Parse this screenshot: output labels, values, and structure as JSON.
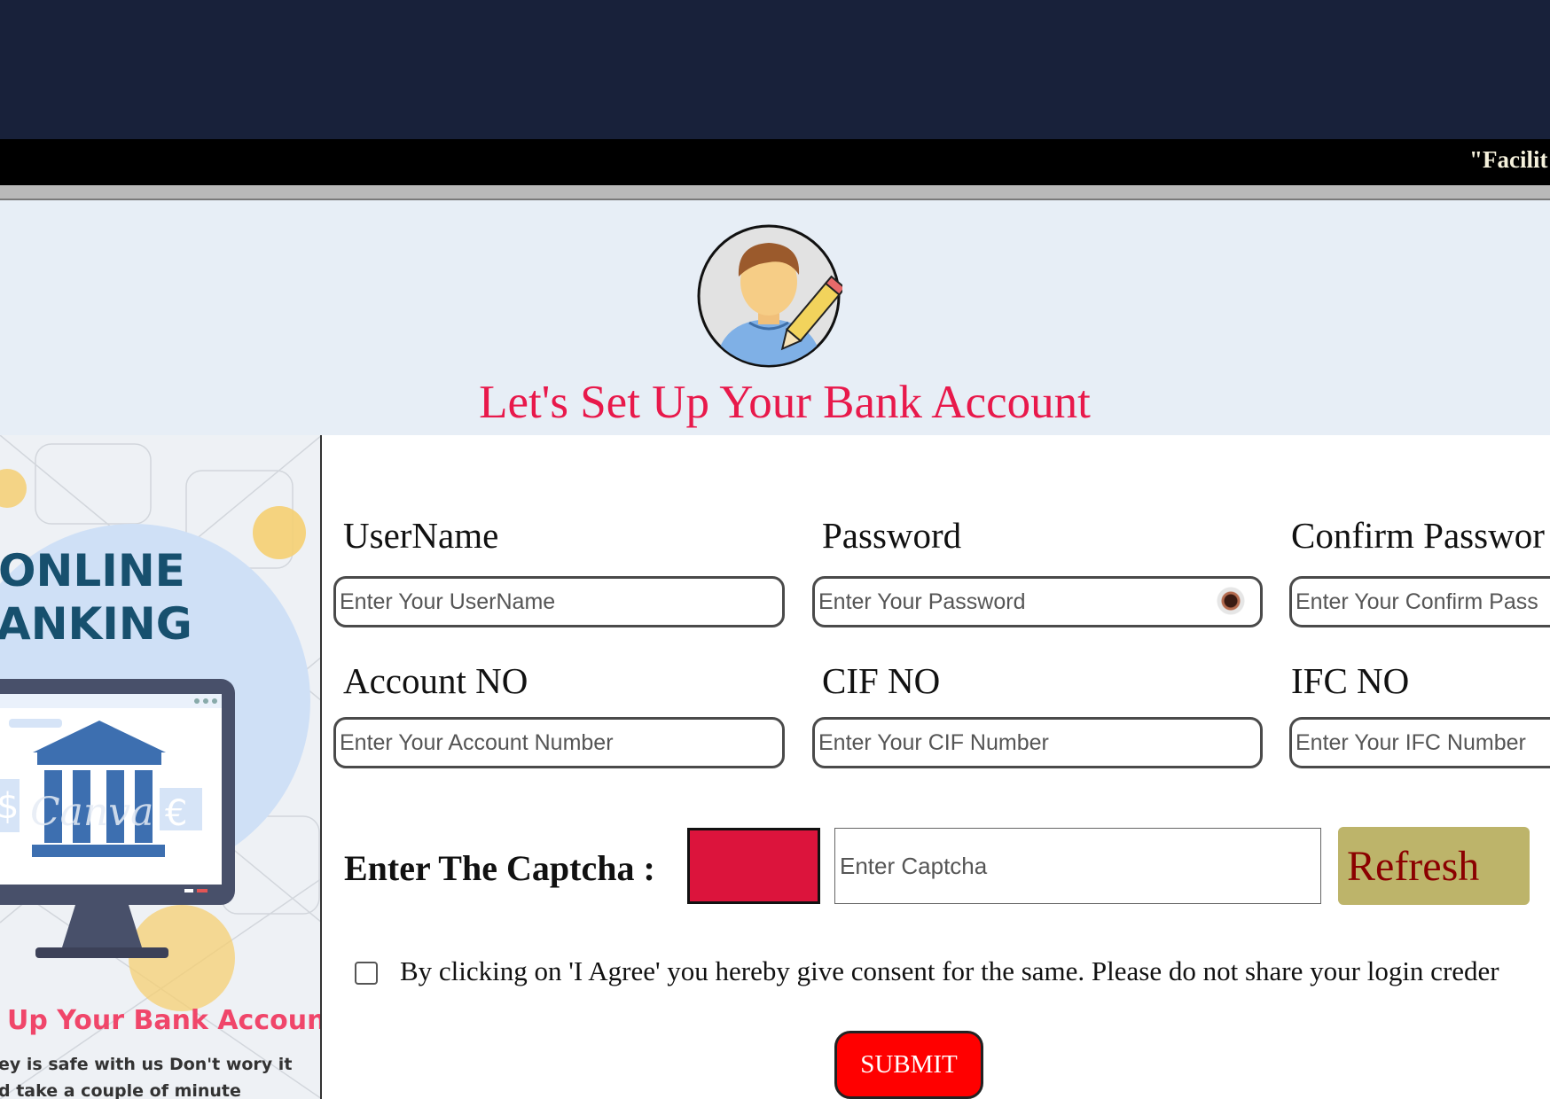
{
  "header": {
    "marquee_text": "\"Facilit"
  },
  "hero": {
    "title": "Let's Set Up Your Bank Account",
    "avatar_icon": "user-edit-icon"
  },
  "promo": {
    "heading_line1": "ONLINE",
    "heading_line2": "ANKING",
    "tagline": "Up Your Bank Account",
    "sub_line1": "ey is safe with us Don't wory it",
    "sub_line2": "d take a couple of minute",
    "watermark": "Canva",
    "icon": "bank-monitor-icon"
  },
  "form": {
    "username": {
      "label": "UserName",
      "placeholder": "Enter Your UserName"
    },
    "password": {
      "label": "Password",
      "placeholder": "Enter Your Password",
      "toggle_icon": "eye-icon"
    },
    "confirm_password": {
      "label": "Confirm Passwor",
      "placeholder": "Enter Your Confirm Pass"
    },
    "account_no": {
      "label": "Account NO",
      "placeholder": "Enter Your Account Number"
    },
    "cif_no": {
      "label": "CIF NO",
      "placeholder": "Enter Your CIF Number"
    },
    "ifc_no": {
      "label": "IFC NO",
      "placeholder": "Enter Your IFC Number"
    }
  },
  "captcha": {
    "label": "Enter The Captcha :",
    "placeholder": "Enter Captcha",
    "refresh_label": "Refresh",
    "box_color": "#dc143c"
  },
  "agreement": {
    "text": "By clicking on 'I Agree' you hereby give consent for the same. Please do not share your login creder"
  },
  "submit": {
    "label": "SUBMIT"
  },
  "colors": {
    "header_bg": "#18213a",
    "title_color": "#e8194b",
    "refresh_bg": "#bdb46a",
    "refresh_text": "#8b0000",
    "submit_bg": "#ff0000"
  }
}
